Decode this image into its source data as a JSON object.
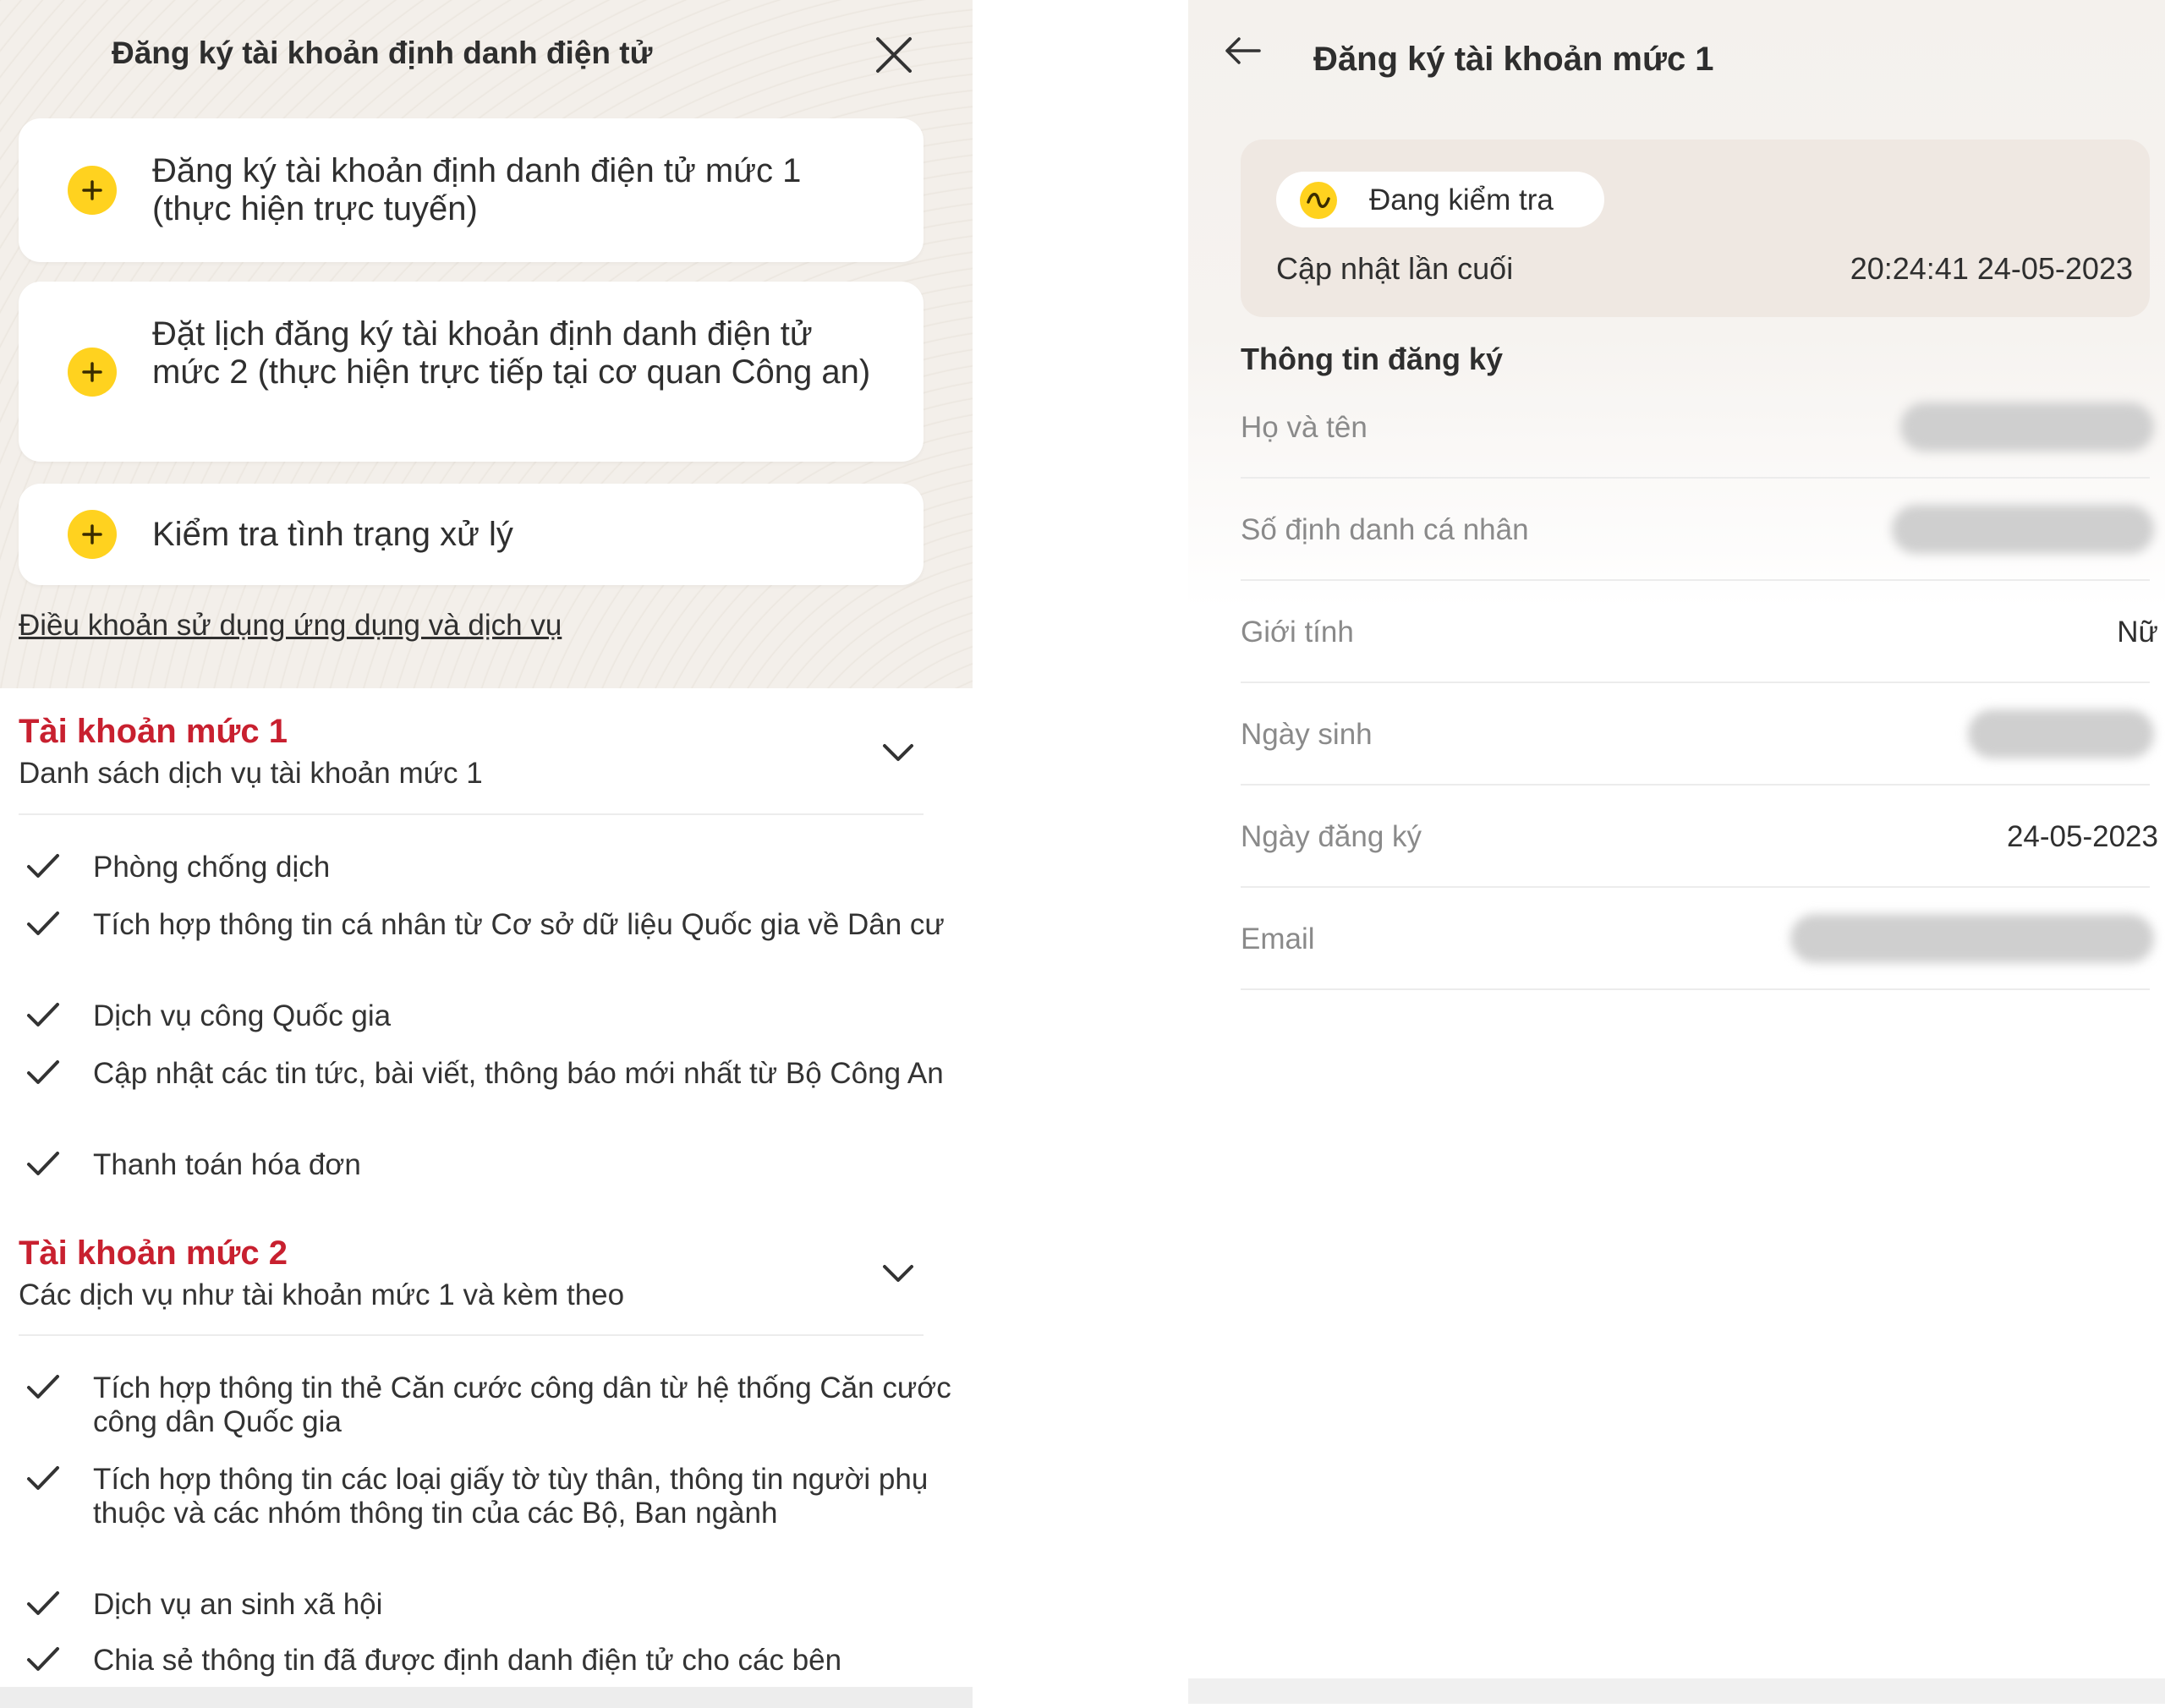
{
  "left": {
    "title": "Đăng ký tài khoản định danh điện tử",
    "options": [
      {
        "label": "Đăng ký tài khoản định danh điện tử mức 1 (thực hiện trực tuyến)"
      },
      {
        "label": "Đặt lịch đăng ký tài khoản định danh điện tử mức 2 (thực hiện trực tiếp tại cơ quan Công an)"
      },
      {
        "label": "Kiểm tra tình trạng xử lý"
      }
    ],
    "terms_link": "Điều khoản sử dụng ứng dụng và dịch vụ",
    "level1": {
      "title": "Tài khoản mức 1",
      "subtitle": "Danh sách dịch vụ tài khoản mức 1",
      "items": [
        "Phòng chống dịch",
        "Tích hợp thông tin cá nhân từ Cơ sở dữ liệu Quốc gia về Dân cư",
        "Dịch vụ công Quốc gia",
        "Cập nhật các tin tức, bài viết, thông báo mới nhất từ Bộ Công An",
        "Thanh toán hóa đơn"
      ]
    },
    "level2": {
      "title": "Tài khoản mức 2",
      "subtitle": "Các dịch vụ như tài khoản mức 1 và kèm theo",
      "items": [
        "Tích hợp thông tin thẻ Căn cước công dân từ hệ thống Căn cước công dân Quốc gia",
        "Tích hợp thông tin các loại giấy tờ tùy thân, thông tin người phụ thuộc và các nhóm thông tin của các Bộ, Ban ngành",
        "Dịch vụ an sinh xã hội",
        "Chia sẻ thông tin đã được định danh điện tử cho các bên"
      ]
    }
  },
  "right": {
    "title": "Đăng ký tài khoản mức 1",
    "status": {
      "label": "Đang kiểm tra",
      "last_update_label": "Cập nhật lần cuối",
      "last_update_value": "20:24:41 24-05-2023"
    },
    "section_heading": "Thông tin đăng ký",
    "fields": [
      {
        "label": "Họ và tên",
        "value": ""
      },
      {
        "label": "Số định danh cá nhân",
        "value": ""
      },
      {
        "label": "Giới tính",
        "value": "Nữ"
      },
      {
        "label": "Ngày sinh",
        "value": ""
      },
      {
        "label": "Ngày đăng ký",
        "value": "24-05-2023"
      },
      {
        "label": "Email",
        "value": ""
      }
    ]
  },
  "colors": {
    "accent_yellow": "#ffd21f",
    "section_red": "#c8202f",
    "panel_beige": "#f3efea"
  },
  "icons": [
    "close-icon",
    "plus-icon",
    "chevron-down-icon",
    "check-icon",
    "back-arrow-icon",
    "pending-icon"
  ]
}
